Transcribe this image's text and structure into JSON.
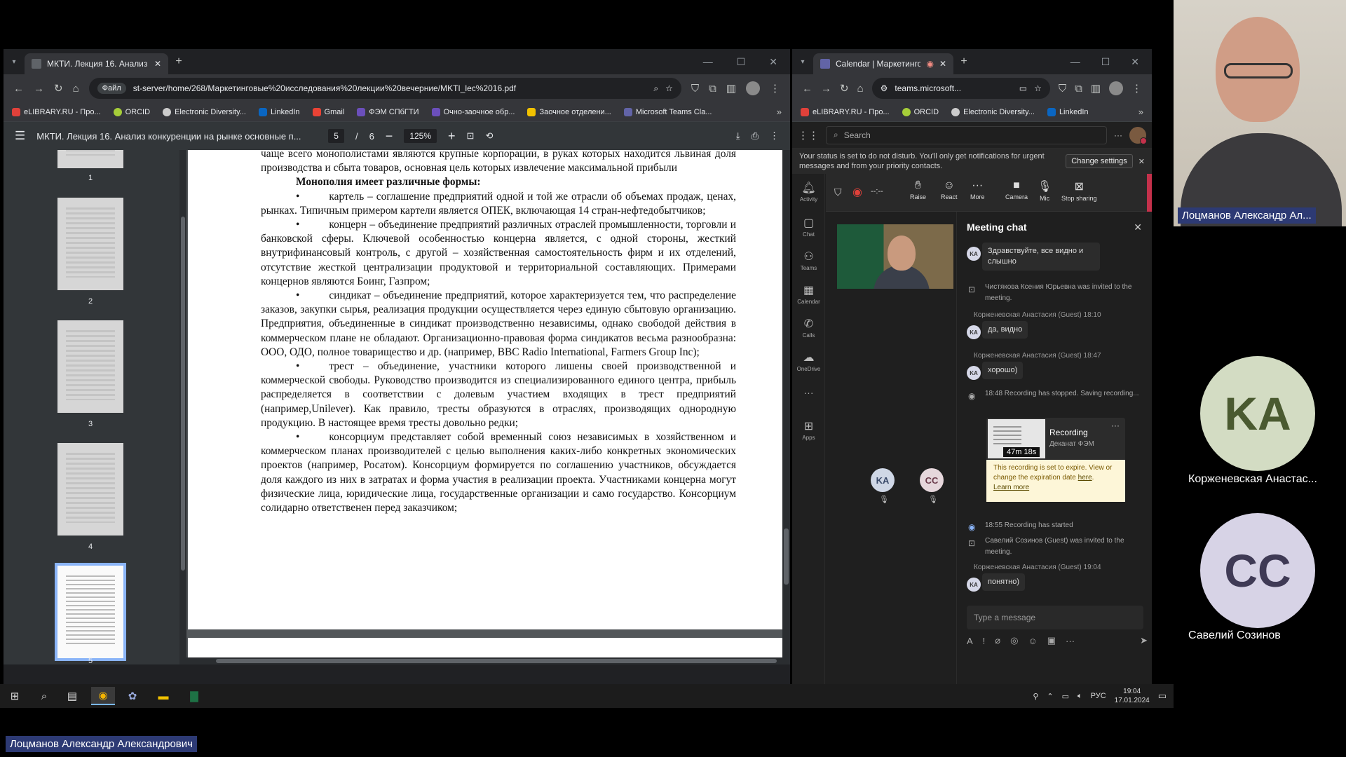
{
  "left_window": {
    "tab_title": "МКТИ. Лекция 16. Анализ ко",
    "url_chip": "Файл",
    "url": "st-server/home/268/Маркетинговые%20исследования%20лекции%20вечерние/MKTI_lec%2016.pdf",
    "bookmarks": [
      "eLIBRARY.RU - Про...",
      "ORCID",
      "Electronic Diversity...",
      "LinkedIn",
      "Gmail",
      "ФЭМ СПбГТИ",
      "Очно-заочное обр...",
      "Заочное отделени...",
      "Microsoft Teams Cla..."
    ],
    "pdf": {
      "title": "МКТИ. Лекция 16. Анализ конкуренции на рынке основные п...",
      "page_current": "5",
      "page_sep": "/",
      "page_total": "6",
      "zoom": "125%",
      "thumb_numbers": [
        "1",
        "2",
        "3",
        "4",
        "5"
      ],
      "text": {
        "p0a": "чаще всего монополистами являются крупные корпорации, в руках которых находится львиная доля производства и сбыта товаров, основная цель которых извлечение максимальной прибыли",
        "heading": "Монополия имеет различные формы:",
        "b1": "картель – соглашение предприятий одной и той же отрасли об объемах продаж, ценах, рынках. Типичным примером картели является ОПЕК, включающая 14 стран-нефтедобытчиков;",
        "b2": "концерн – объединение предприятий различных отраслей промышленности, торговли и банковской сферы. Ключевой особенностью концерна является, с одной стороны, жесткий внутрифинансовый контроль, с другой – хозяйственная самостоятельность фирм и их отделений, отсутствие жесткой централизации продуктовой и территориальной составляющих. Примерами концернов являются Боинг, Газпром;",
        "b3": "синдикат – объединение предприятий, которое характеризуется тем, что распределение заказов, закупки сырья, реализация продукции осуществляется через единую сбытовую организацию. Предприятия, объединенные в синдикат производственно независимы, однако свободой действия в коммерческом плане не обладают. Организационно-правовая форма синдикатов весьма разнообразна: ООО, ОДО, полное товарищество и др. (например, BBC Radio International, Farmers Group Inc);",
        "b4": "трест – объединение, участники которого лишены своей производственной и коммерческой свободы. Руководство производится из специализированного единого центра, прибыль распределяется в соответствии с долевым участием входящих в трест предприятий (например,Unilever). Как правило, тресты образуются в отраслях, производящих однородную продукцию. В настоящее время тресты довольно редки;",
        "b5": "консорциум представляет собой временный союз независимых в хозяйственном и коммерческом планах производителей с целью выполнения каких-либо конкретных экономических проектов (например, Росатом). Консорциум формируется по соглашению участников, обсуждается доля каждого из них в затратах и форма участия в реализации проекта. Участниками концерна могут физические лица, юридические лица, государственные организации и само государство. Консорциум солидарно ответственен перед заказчиком;",
        "bullet": "•"
      }
    }
  },
  "right_window": {
    "tab_title": "Calendar | Маркетинговые",
    "url": "teams.microsoft...",
    "bookmarks": [
      "eLIBRARY.RU - Про...",
      "ORCID",
      "Electronic Diversity...",
      "LinkedIn"
    ],
    "search_placeholder": "Search",
    "status_msg": "Your status is set to do not disturb. You'll only get notifications for urgent messages and from your priority contacts.",
    "change_settings": "Change settings",
    "rail": [
      "Activity",
      "Chat",
      "Teams",
      "Calendar",
      "Calls",
      "OneDrive",
      "Apps"
    ],
    "timer": "--:--",
    "call_buttons": [
      "Raise",
      "React",
      "More",
      "Camera",
      "Mic",
      "Stop sharing"
    ],
    "participants": [
      "KA",
      "CC"
    ],
    "chat": {
      "title": "Meeting chat",
      "msg1": "Здравствуйте, все видно и слышно",
      "sys1": "Чистякова Ксения Юрьевна was invited to the meeting.",
      "meta2": "Корженевская Анастасия (Guest)  18:10",
      "msg2": "да, видно",
      "meta3": "Корженевская Анастасия (Guest)  18:47",
      "msg3": "хорошо)",
      "sys2": "18:48   Recording has stopped. Saving recording...",
      "rec_title": "Recording",
      "rec_sub": "Деканат ФЭМ",
      "rec_dur": "47m 18s",
      "rec_notice_a": "This recording is set to expire. View or change the expiration date",
      "rec_notice_here": "here",
      "rec_learn": "Learn more",
      "sys3": "18:55   Recording has started",
      "sys4": "Савелий Созинов (Guest) was invited to the meeting.",
      "meta4": "Корженевская Анастасия (Guest)  19:04",
      "msg4": "понятно)",
      "compose_placeholder": "Type a message",
      "avatar_initials": "KA"
    }
  },
  "side_panel": {
    "main_name": "Лоцманов Александр Ал...",
    "p1_initials": "KA",
    "p1_name": "Корженевская Анастас...",
    "p2_initials": "CC",
    "p2_name": "Савелий Созинов",
    "p1_color": "#d3dcc3",
    "p2_color": "#d7d3e6"
  },
  "taskbar": {
    "lang": "РУС",
    "time": "19:04",
    "date": "17.01.2024"
  },
  "bottom_label": "Лоцманов Александр Александрович"
}
